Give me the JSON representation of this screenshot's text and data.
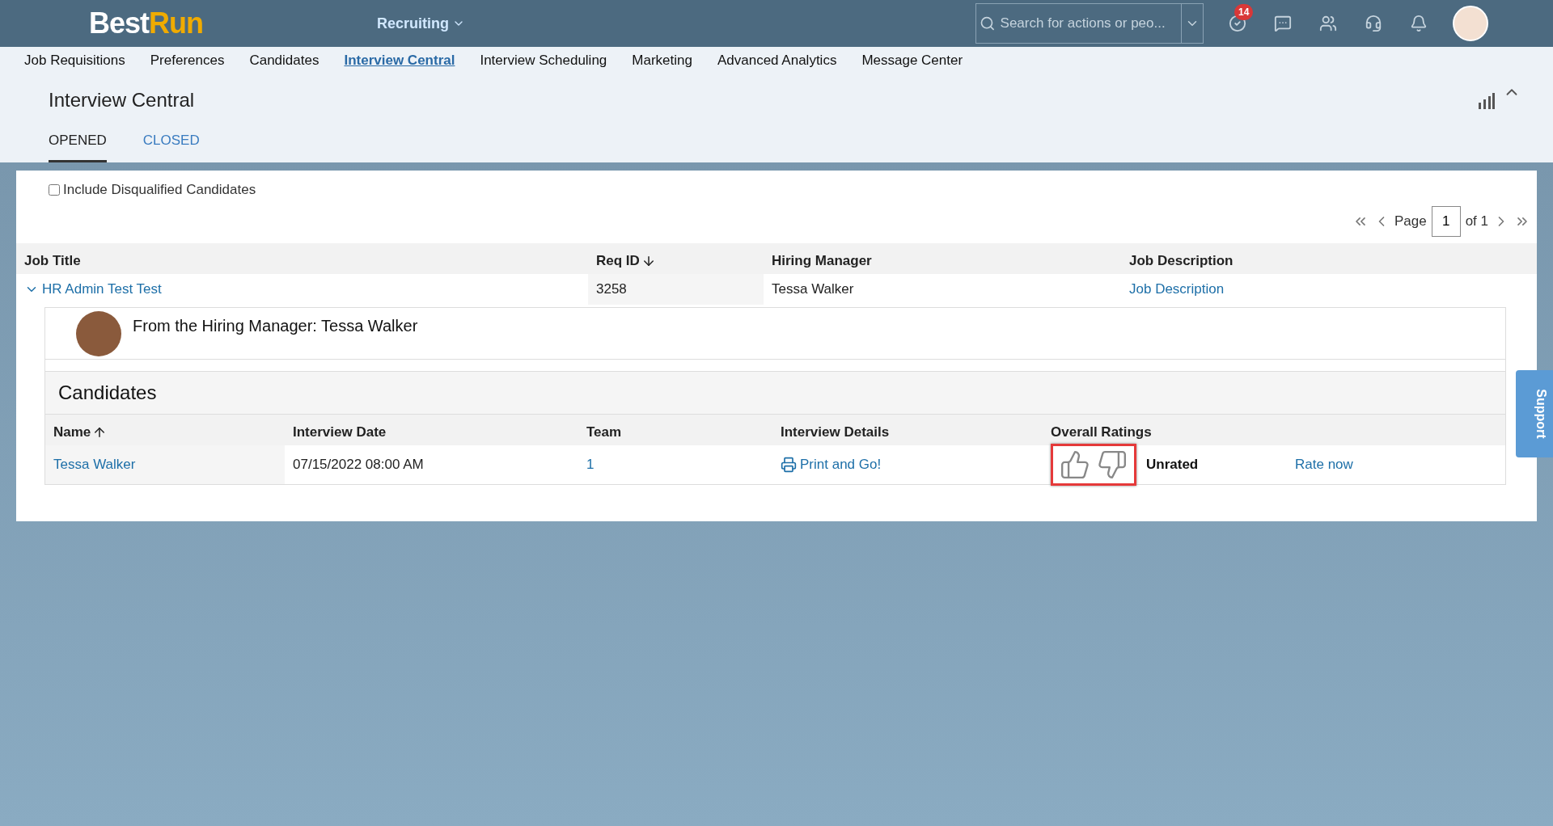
{
  "header": {
    "logo": {
      "part_1": "Best",
      "part_2": "Run"
    },
    "module": "Recruiting",
    "search": {
      "placeholder": "Search for actions or peo..."
    },
    "notification_count": "14"
  },
  "nav": [
    {
      "label": "Job Requisitions",
      "selected": false
    },
    {
      "label": "Preferences",
      "selected": false
    },
    {
      "label": "Candidates",
      "selected": false
    },
    {
      "label": "Interview Central",
      "selected": true
    },
    {
      "label": "Interview Scheduling",
      "selected": false
    },
    {
      "label": "Marketing",
      "selected": false
    },
    {
      "label": "Advanced Analytics",
      "selected": false
    },
    {
      "label": "Message Center",
      "selected": false
    }
  ],
  "page_title": "Interview Central",
  "tabs": [
    {
      "label": "OPENED",
      "selected": true
    },
    {
      "label": "CLOSED",
      "selected": false
    }
  ],
  "include_disqualified": {
    "label": "Include Disqualified Candidates",
    "checked": false
  },
  "pagination": {
    "label": "Page",
    "value": "1",
    "total": "of 1"
  },
  "table": {
    "columns": [
      "Job Title",
      "Req ID",
      "Hiring Manager",
      "Job Description"
    ],
    "rows": [
      {
        "job_title": "HR Admin Test Test",
        "req_id": "3258",
        "hiring_manager": "Tessa Walker",
        "job_description": "Job Description",
        "expanded": true,
        "detail": {
          "manager_note": "From the Hiring Manager: Tessa Walker",
          "section_title": "Candidates",
          "columns": [
            "Name",
            "Interview Date",
            "Team",
            "Interview Details",
            "Overall Ratings"
          ],
          "candidates": [
            {
              "name": "Tessa Walker",
              "interview_date": "07/15/2022 08:00 AM",
              "team": "1",
              "details": "Print and Go!",
              "rating": "Unrated",
              "rate_link": "Rate now",
              "highlighted": true
            }
          ]
        }
      }
    ]
  },
  "support_tab": "Support"
}
